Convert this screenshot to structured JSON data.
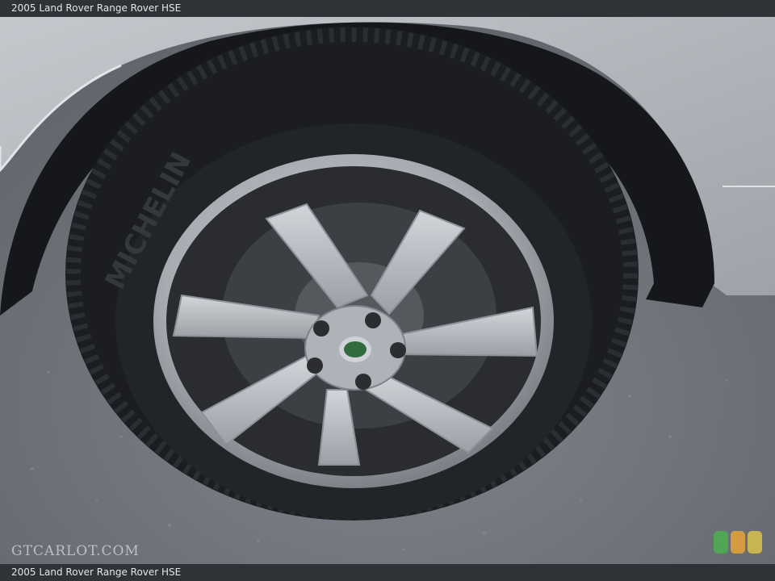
{
  "caption": {
    "top": "2005 Land Rover Range Rover HSE",
    "bottom": "2005 Land Rover Range Rover HSE"
  },
  "watermark": {
    "text": "GTCARLOT.COM"
  },
  "badge": {
    "colors": [
      "#4caf50",
      "#e8a33a",
      "#d9c24a"
    ]
  },
  "photo": {
    "subject": "wheel-icon"
  }
}
